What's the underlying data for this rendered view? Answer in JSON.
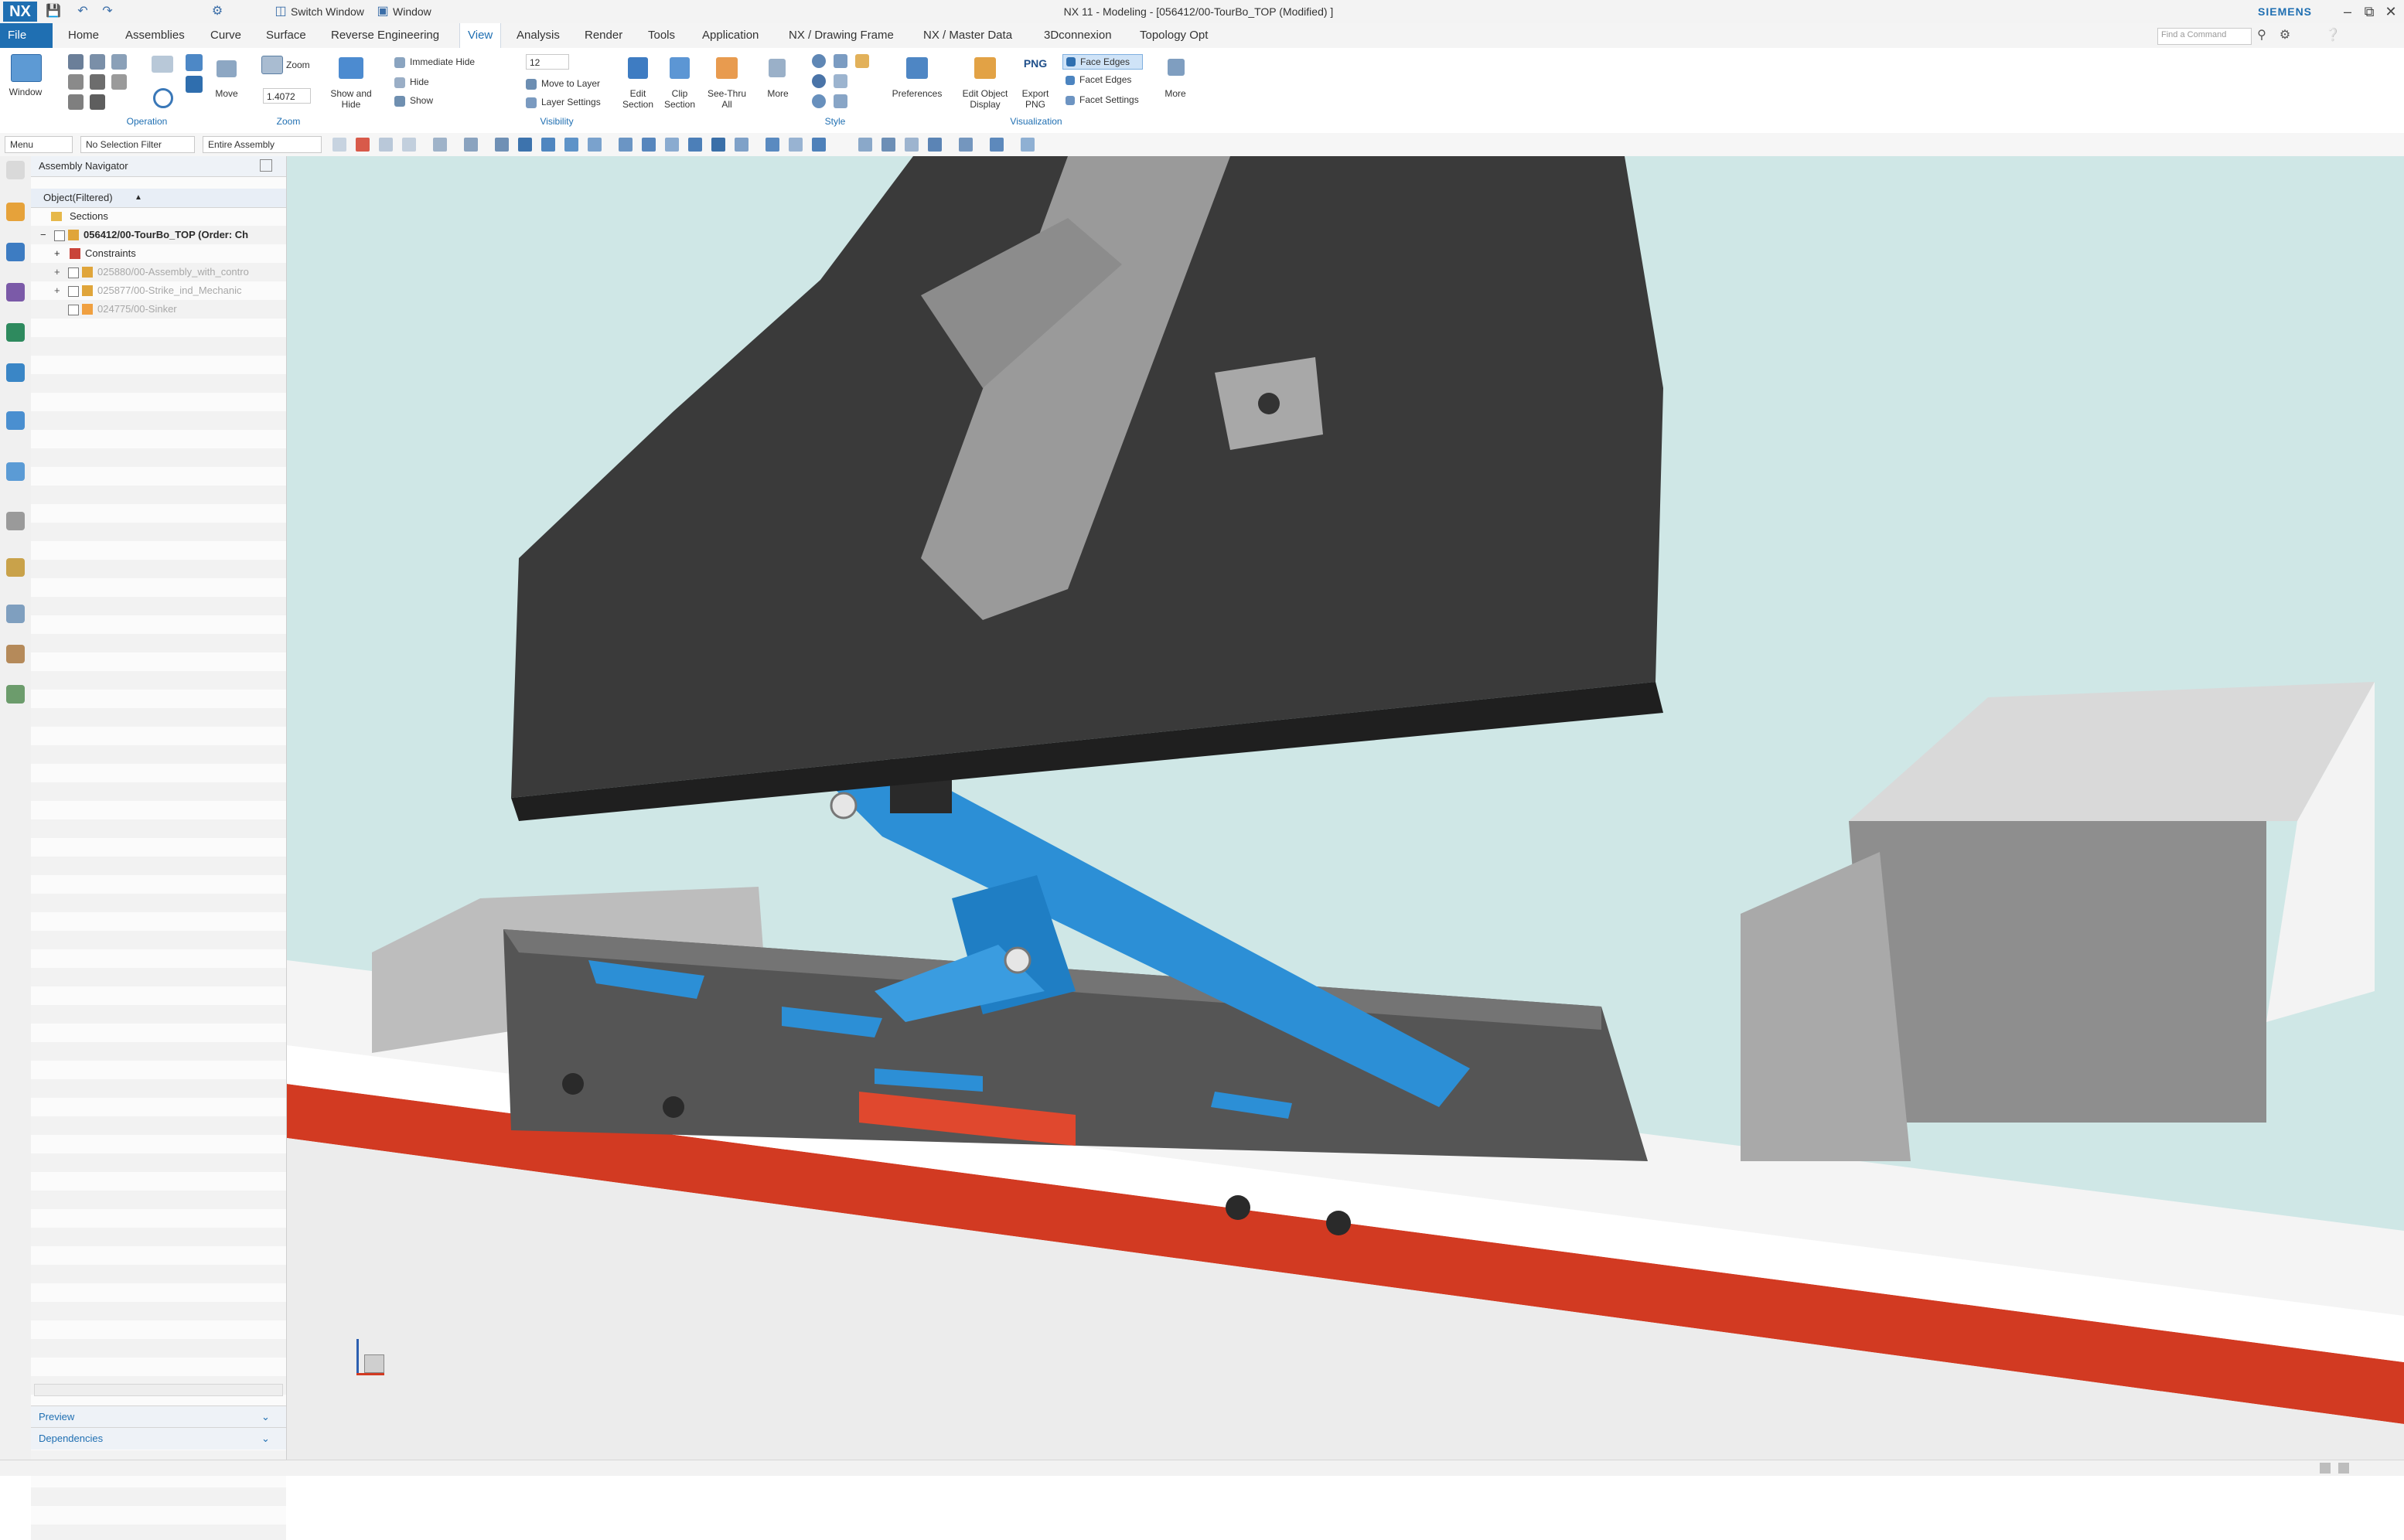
{
  "app": {
    "logo": "NX",
    "title": "NX 11 - Modeling - [056412/00-TourBo_TOP (Modified)  ]",
    "brand": "SIEMENS",
    "switch_window": "Switch Window",
    "window_menu": "Window",
    "command_search_placeholder": "Find a Command"
  },
  "tabs": [
    "File",
    "Home",
    "Assemblies",
    "Curve",
    "Surface",
    "Reverse Engineering",
    "View",
    "Analysis",
    "Render",
    "Tools",
    "Application",
    "NX / Drawing Frame",
    "NX / Master Data",
    "3Dconnexion",
    "Topology Opt"
  ],
  "active_tab": "View",
  "ribbon": {
    "window_label": "Window",
    "operation_group": "Operation",
    "move_label": "Move",
    "zoom_label": "Zoom",
    "zoom_value": "1.4072",
    "zoom_group": "Zoom",
    "show_hide_label": "Show and Hide",
    "immediate_hide": "Immediate Hide",
    "hide": "Hide",
    "show": "Show",
    "layer_value": "12",
    "move_to_layer": "Move to Layer",
    "layer_settings": "Layer Settings",
    "visibility_group": "Visibility",
    "edit_section": "Edit Section",
    "clip_section": "Clip Section",
    "see_thru_all": "See-Thru All",
    "more_label": "More",
    "style_group": "Style",
    "preferences": "Preferences",
    "edit_object_display": "Edit Object Display",
    "export_png": "Export PNG",
    "png_badge": "PNG",
    "face_edges": "Face Edges",
    "facet_edges": "Facet Edges",
    "facet_settings": "Facet Settings",
    "visualization_group": "Visualization",
    "more_right": "More"
  },
  "selection_bar": {
    "menu": "Menu",
    "filter": "No Selection Filter",
    "scope": "Entire Assembly"
  },
  "navigator": {
    "title": "Assembly Navigator",
    "column": "Object(Filtered)",
    "rows": [
      {
        "label": "Sections"
      },
      {
        "label": "056412/00-TourBo_TOP (Order: Ch"
      },
      {
        "label": "Constraints"
      },
      {
        "label": "025880/00-Assembly_with_contro"
      },
      {
        "label": "025877/00-Strike_ind_Mechanic"
      },
      {
        "label": "024775/00-Sinker"
      }
    ],
    "preview": "Preview",
    "dependencies": "Dependencies"
  },
  "colors": {
    "ui_blue": "#1f6fb2",
    "viewport_bg": "#cfe7e6",
    "boot": "#3a3a3a",
    "part_blue": "#2c8fd6",
    "ski_red": "#d23a22"
  },
  "icons": [
    "window-icon",
    "move-icon",
    "zoom-icon",
    "show-hide-icon",
    "edit-section-icon",
    "clip-section-icon",
    "see-thru-icon",
    "preferences-icon",
    "edit-object-display-icon",
    "export-png-icon",
    "wcs-triad-icon"
  ]
}
